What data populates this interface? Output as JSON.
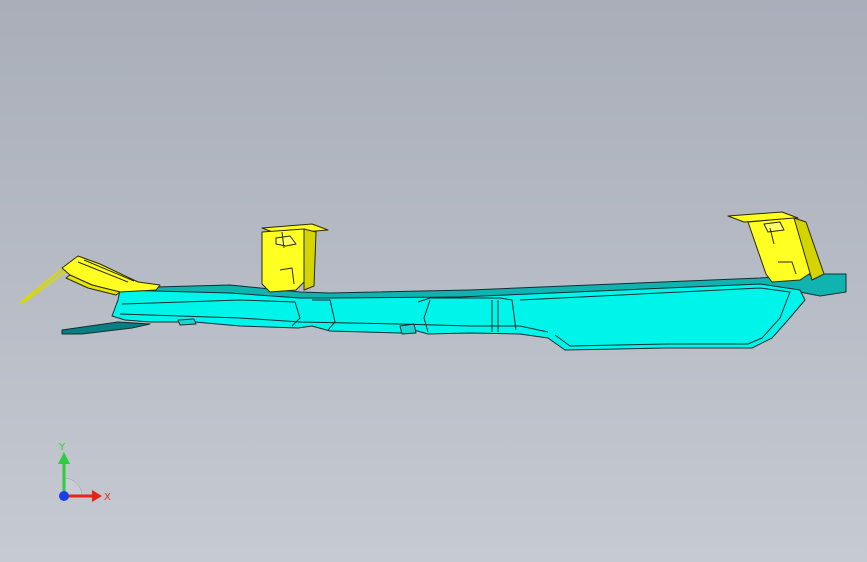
{
  "viewport": {
    "model_name": "",
    "colors": {
      "background_top": "#a9aeb9",
      "background_bottom": "#c6cad2",
      "main_part_fill": "#00f5ea",
      "main_part_shadow": "#00b3b0",
      "main_part_edge": "#0f2f33",
      "bracket_fill": "#ffff22",
      "bracket_edge": "#2b2b00"
    }
  },
  "triad": {
    "y_label": "Y",
    "x_label": "X",
    "colors": {
      "y_axis": "#2ecc40",
      "x_axis": "#e8231a",
      "z_axis": "#1a3fe8"
    }
  }
}
